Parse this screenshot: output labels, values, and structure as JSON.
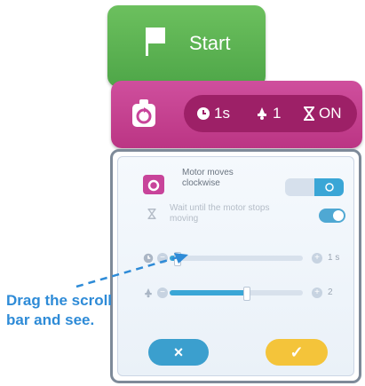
{
  "start_block": {
    "label": "Start"
  },
  "motor_block": {
    "params": {
      "time": "1s",
      "motor": "1",
      "wait": "ON"
    }
  },
  "panel": {
    "direction_label": "Motor moves clockwise",
    "wait_label": "Wait until the motor stops moving",
    "duration_slider": {
      "value_text": "1 s",
      "level": 0.05
    },
    "motor_slider": {
      "value_text": "2",
      "level": 0.57
    },
    "cancel_symbol": "×",
    "confirm_symbol": "✓"
  },
  "annotation": {
    "text": "Drag the scroll bar and see."
  },
  "colors": {
    "start": "#56ad4c",
    "motor": "#c8449a",
    "panel_accent": "#3aa6d6",
    "confirm": "#f4c43a",
    "annotation": "#2e8bd7"
  }
}
